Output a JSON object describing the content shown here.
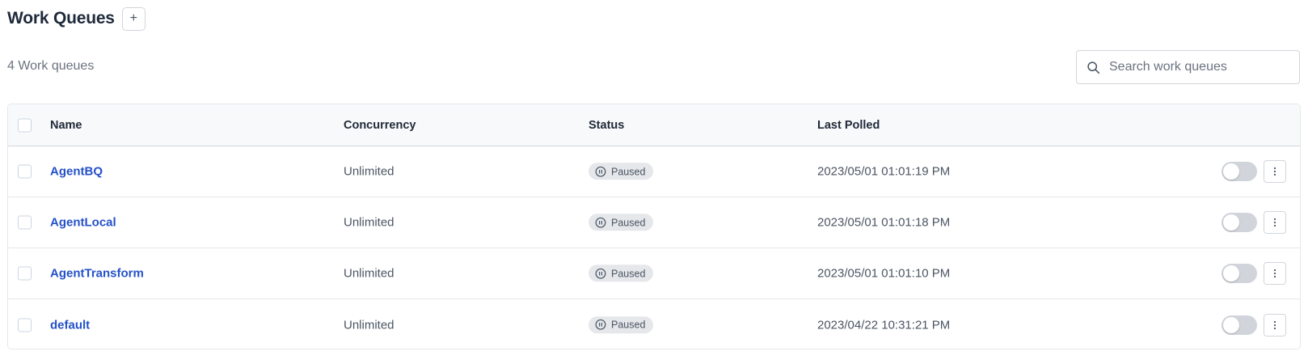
{
  "header": {
    "title": "Work Queues",
    "add_label": "+"
  },
  "summary": {
    "count_label": "4 Work queues"
  },
  "search": {
    "placeholder": "Search work queues",
    "value": ""
  },
  "table": {
    "columns": {
      "name": "Name",
      "concurrency": "Concurrency",
      "status": "Status",
      "last_polled": "Last Polled"
    },
    "rows": [
      {
        "name": "AgentBQ",
        "concurrency": "Unlimited",
        "status": "Paused",
        "last_polled": "2023/05/01 01:01:19 PM",
        "enabled": false
      },
      {
        "name": "AgentLocal",
        "concurrency": "Unlimited",
        "status": "Paused",
        "last_polled": "2023/05/01 01:01:18 PM",
        "enabled": false
      },
      {
        "name": "AgentTransform",
        "concurrency": "Unlimited",
        "status": "Paused",
        "last_polled": "2023/05/01 01:01:10 PM",
        "enabled": false
      },
      {
        "name": "default",
        "concurrency": "Unlimited",
        "status": "Paused",
        "last_polled": "2023/04/22 10:31:21 PM",
        "enabled": false
      }
    ]
  },
  "icons": {
    "search": "search-icon",
    "status": "pause-circle-icon",
    "menu": "kebab-menu-icon"
  },
  "colors": {
    "link": "#2451c9",
    "badge_bg": "#e5e7eb",
    "toggle_off": "#d1d5db"
  }
}
